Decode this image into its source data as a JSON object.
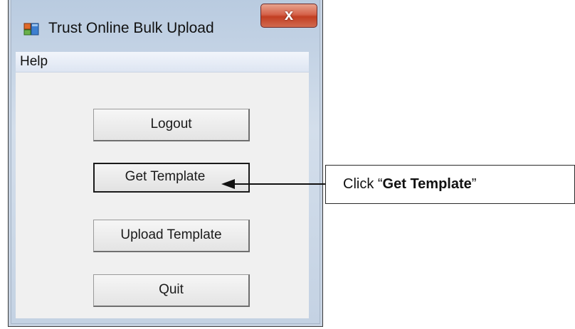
{
  "window": {
    "title": "Trust Online Bulk Upload",
    "close_glyph": "x",
    "app_icon": "form-window-icon"
  },
  "menu": {
    "help_label": "Help"
  },
  "buttons": {
    "logout": "Logout",
    "get_template": "Get Template",
    "upload_template": "Upload Template",
    "quit": "Quit"
  },
  "callout": {
    "prefix": "Click “",
    "emphasis": "Get Template",
    "suffix": "”"
  }
}
